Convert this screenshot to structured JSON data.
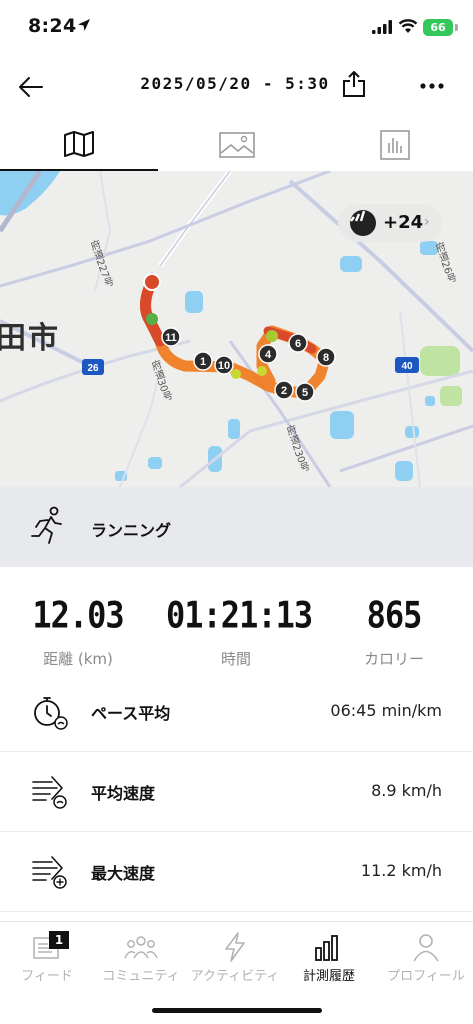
{
  "status_bar": {
    "time": "8:24",
    "battery": "66"
  },
  "header": {
    "title": "2025/05/20 - 5:30",
    "back_icon": "back-arrow-icon",
    "share_icon": "share-icon",
    "more_icon": "more-icon"
  },
  "tabs": [
    {
      "name": "map",
      "icon": "map-icon",
      "selected": true
    },
    {
      "name": "photos",
      "icon": "image-icon",
      "selected": false
    },
    {
      "name": "stats",
      "icon": "bar-chart-icon",
      "selected": false
    }
  ],
  "map": {
    "city_label": "田市",
    "partner_count": "+24",
    "road_labels": [
      "府道227号",
      "府道30号",
      "府道230号",
      "府道26号"
    ],
    "route_shields": [
      "26",
      "40"
    ],
    "km_markers": [
      "1",
      "2",
      "4",
      "5",
      "6",
      "8",
      "10",
      "11"
    ],
    "colors": {
      "route_fast": "#f07a1d",
      "route_slow": "#d94a2b",
      "route_green": "#a7c930",
      "water": "#8fd0f2",
      "park": "#bfe3a0",
      "shield": "#1d57c2"
    }
  },
  "activity": {
    "label": "ランニング",
    "icon": "running-icon"
  },
  "stats": {
    "distance": {
      "value": "12.03",
      "label": "距離 (km)"
    },
    "duration": {
      "value": "01:21:13",
      "label": "時間"
    },
    "calories": {
      "value": "865",
      "label": "カロリー"
    }
  },
  "metrics": {
    "pace": {
      "label": "ペース平均",
      "value": "06:45 min/km",
      "icon": "stopwatch-icon"
    },
    "avg_speed": {
      "label": "平均速度",
      "value": "8.9 km/h",
      "icon": "speed-average-icon"
    },
    "max_speed": {
      "label": "最大速度",
      "value": "11.2 km/h",
      "icon": "speed-max-icon"
    }
  },
  "bottom_nav": {
    "feed_badge": "1",
    "items": [
      {
        "label": "フィード",
        "icon": "feed-icon",
        "active": false
      },
      {
        "label": "コミュニティ",
        "icon": "community-icon",
        "active": false
      },
      {
        "label": "アクティビティ",
        "icon": "activity-bolt-icon",
        "active": false
      },
      {
        "label": "計測履歴",
        "icon": "history-chart-icon",
        "active": true
      },
      {
        "label": "プロフィール",
        "icon": "profile-icon",
        "active": false
      }
    ]
  }
}
